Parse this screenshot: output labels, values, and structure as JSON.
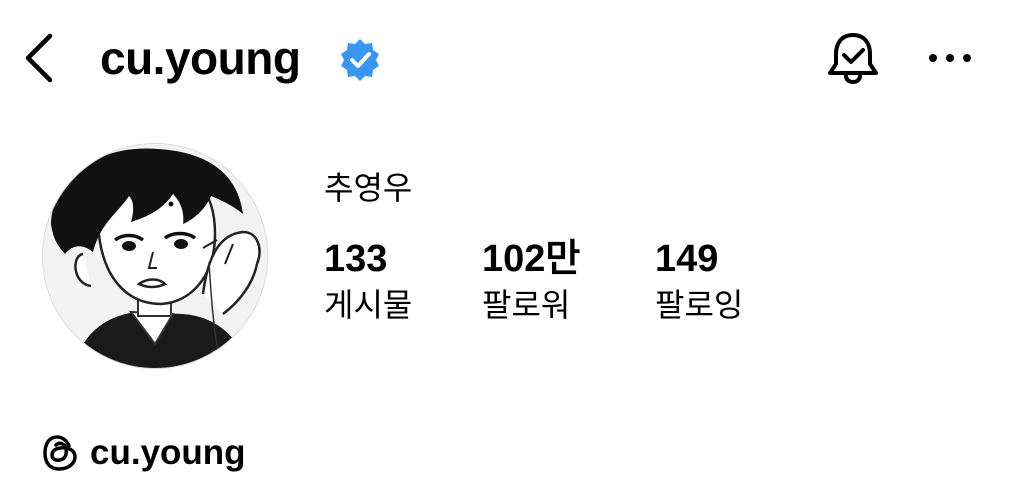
{
  "header": {
    "username": "cu.young",
    "verified": true,
    "icons": {
      "back": "back-chevron-icon",
      "verified": "verified-badge-icon",
      "bell": "notification-bell-icon",
      "more": "more-dots-icon"
    }
  },
  "profile": {
    "display_name": "추영우",
    "avatar_icon": "profile-avatar"
  },
  "stats": [
    {
      "count": "133",
      "label": "게시물"
    },
    {
      "count": "102만",
      "label": "팔로워"
    },
    {
      "count": "149",
      "label": "팔로잉"
    }
  ],
  "threads": {
    "handle": "cu.young",
    "icon": "threads-logo-icon"
  },
  "colors": {
    "verified_blue": "#3897F0",
    "text": "#000000",
    "background": "#FFFFFF"
  }
}
